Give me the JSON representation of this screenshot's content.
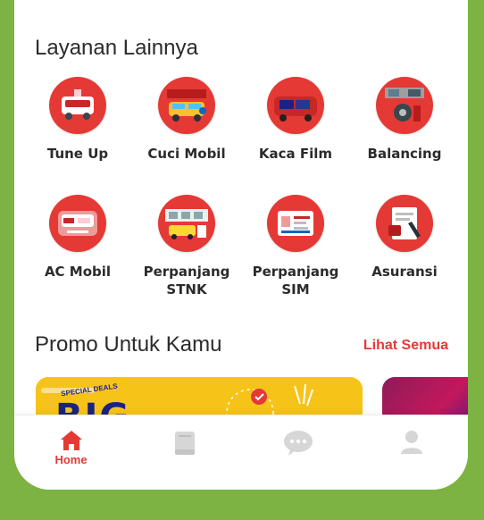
{
  "section_title": "Layanan Lainnya",
  "services": [
    {
      "label": "Tune Up",
      "icon": "tune-up-icon"
    },
    {
      "label": "Cuci Mobil",
      "icon": "car-wash-icon"
    },
    {
      "label": "Kaca Film",
      "icon": "window-film-icon"
    },
    {
      "label": "Balancing",
      "icon": "balancing-icon"
    },
    {
      "label": "AC Mobil",
      "icon": "car-ac-icon"
    },
    {
      "label": "Perpanjang STNK",
      "icon": "stnk-renewal-icon"
    },
    {
      "label": "Perpanjang SIM",
      "icon": "sim-renewal-icon"
    },
    {
      "label": "Asuransi",
      "icon": "insurance-icon"
    }
  ],
  "promo": {
    "title": "Promo Untuk Kamu",
    "link": "Lihat Semua",
    "card_text": "BIG",
    "card_small": "SPECIAL DEALS"
  },
  "nav": {
    "home_label": "Home"
  },
  "colors": {
    "accent": "#e53935",
    "background": "#7cb342",
    "promo_yellow": "#f6c319"
  }
}
